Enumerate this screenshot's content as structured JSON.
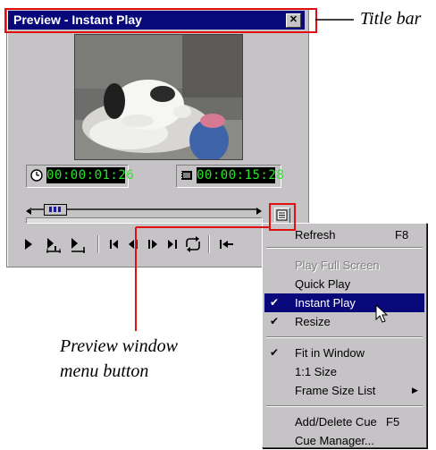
{
  "window": {
    "title": "Preview - Instant Play",
    "close_glyph": "✕"
  },
  "timecodes": {
    "current": "00:00:01:26",
    "duration": "00:00:15:28"
  },
  "menu": {
    "items": [
      {
        "label": "Refresh",
        "shortcut": "F8",
        "checked": false,
        "disabled": false,
        "highlighted": false
      },
      {
        "label": "Play Full Screen",
        "shortcut": "",
        "checked": false,
        "disabled": true,
        "highlighted": false
      },
      {
        "label": "Quick Play",
        "shortcut": "",
        "checked": false,
        "disabled": false,
        "highlighted": false
      },
      {
        "label": "Instant Play",
        "shortcut": "",
        "checked": true,
        "disabled": false,
        "highlighted": true
      },
      {
        "label": "Resize",
        "shortcut": "",
        "checked": true,
        "disabled": false,
        "highlighted": false
      },
      {
        "label": "Fit in Window",
        "shortcut": "",
        "checked": true,
        "disabled": false,
        "highlighted": false
      },
      {
        "label": "1:1 Size",
        "shortcut": "",
        "checked": false,
        "disabled": false,
        "highlighted": false
      },
      {
        "label": "Frame Size List",
        "shortcut": "",
        "checked": false,
        "disabled": false,
        "highlighted": false,
        "submenu": true
      },
      {
        "label": "Add/Delete Cue",
        "shortcut": "F5",
        "checked": false,
        "disabled": false,
        "highlighted": false
      },
      {
        "label": "Cue Manager...",
        "shortcut": "",
        "checked": false,
        "disabled": false,
        "highlighted": false
      }
    ],
    "check_glyph": "✔",
    "submenu_glyph": "▶"
  },
  "callouts": {
    "title_bar": "Title bar",
    "menu_button_line1": "Preview window",
    "menu_button_line2": "menu button"
  },
  "colors": {
    "title_bar": "#08087b",
    "highlight": "#08087b",
    "timecode_text": "#28e628",
    "annotation_red": "#e01010"
  }
}
